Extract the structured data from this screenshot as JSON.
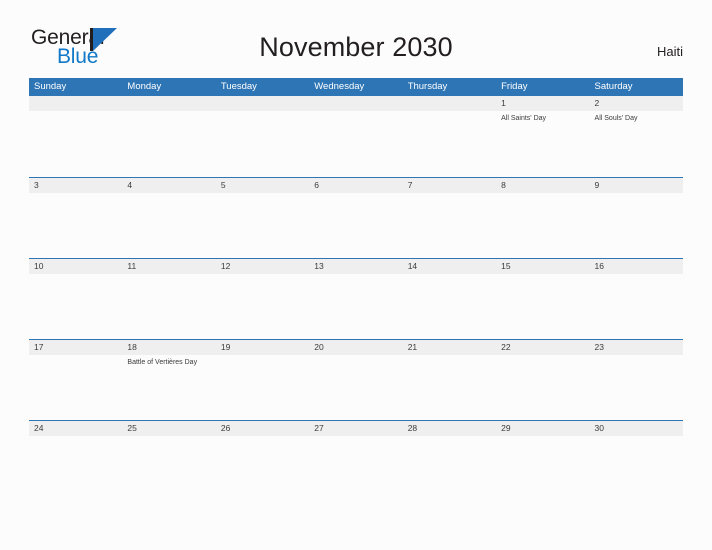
{
  "brand": {
    "name_part1": "General",
    "name_part2": "Blue",
    "mark_icon": "triangle-flag-icon",
    "accent_color": "#1278c8"
  },
  "header": {
    "title": "November 2030",
    "region": "Haiti"
  },
  "theme": {
    "header_blue": "#2e75b6",
    "date_strip_gray": "#efefef",
    "page_background": "#fcfcfd",
    "text_dark": "#231f20"
  },
  "calendar": {
    "month": "November",
    "year": "2030",
    "weekday_headers": [
      "Sunday",
      "Monday",
      "Tuesday",
      "Wednesday",
      "Thursday",
      "Friday",
      "Saturday"
    ],
    "weeks": [
      [
        {
          "date": "",
          "holiday": ""
        },
        {
          "date": "",
          "holiday": ""
        },
        {
          "date": "",
          "holiday": ""
        },
        {
          "date": "",
          "holiday": ""
        },
        {
          "date": "",
          "holiday": ""
        },
        {
          "date": "1",
          "holiday": "All Saints' Day"
        },
        {
          "date": "2",
          "holiday": "All Souls' Day"
        }
      ],
      [
        {
          "date": "3",
          "holiday": ""
        },
        {
          "date": "4",
          "holiday": ""
        },
        {
          "date": "5",
          "holiday": ""
        },
        {
          "date": "6",
          "holiday": ""
        },
        {
          "date": "7",
          "holiday": ""
        },
        {
          "date": "8",
          "holiday": ""
        },
        {
          "date": "9",
          "holiday": ""
        }
      ],
      [
        {
          "date": "10",
          "holiday": ""
        },
        {
          "date": "11",
          "holiday": ""
        },
        {
          "date": "12",
          "holiday": ""
        },
        {
          "date": "13",
          "holiday": ""
        },
        {
          "date": "14",
          "holiday": ""
        },
        {
          "date": "15",
          "holiday": ""
        },
        {
          "date": "16",
          "holiday": ""
        }
      ],
      [
        {
          "date": "17",
          "holiday": ""
        },
        {
          "date": "18",
          "holiday": "Battle of Vertières Day"
        },
        {
          "date": "19",
          "holiday": ""
        },
        {
          "date": "20",
          "holiday": ""
        },
        {
          "date": "21",
          "holiday": ""
        },
        {
          "date": "22",
          "holiday": ""
        },
        {
          "date": "23",
          "holiday": ""
        }
      ],
      [
        {
          "date": "24",
          "holiday": ""
        },
        {
          "date": "25",
          "holiday": ""
        },
        {
          "date": "26",
          "holiday": ""
        },
        {
          "date": "27",
          "holiday": ""
        },
        {
          "date": "28",
          "holiday": ""
        },
        {
          "date": "29",
          "holiday": ""
        },
        {
          "date": "30",
          "holiday": ""
        }
      ]
    ]
  }
}
